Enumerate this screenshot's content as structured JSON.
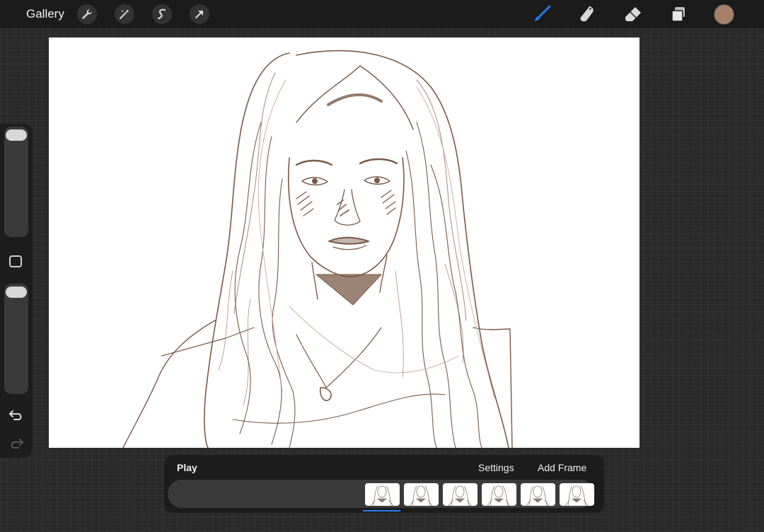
{
  "toolbar": {
    "gallery_label": "Gallery",
    "left_icons": [
      "wrench-icon",
      "magic-wand-icon",
      "selection-s-icon",
      "transform-arrow-icon"
    ],
    "right_icons": [
      "brush-icon",
      "smudge-icon",
      "eraser-icon",
      "layers-icon"
    ],
    "active_tool": "brush",
    "accent_color": "#1f7ce8",
    "current_color": "#a7806a"
  },
  "canvas": {
    "background": "#ffffff",
    "ink_color": "#7a5a48",
    "subject": "pen sketch portrait of a woman with long wavy hair and a pendant necklace"
  },
  "sidebar": {
    "controls": [
      "brush-size-slider",
      "modify-button",
      "opacity-slider",
      "undo-button",
      "redo-button"
    ]
  },
  "timeline": {
    "play_label": "Play",
    "settings_label": "Settings",
    "add_frame_label": "Add Frame",
    "frame_count": 6,
    "selected_frame": 1
  }
}
